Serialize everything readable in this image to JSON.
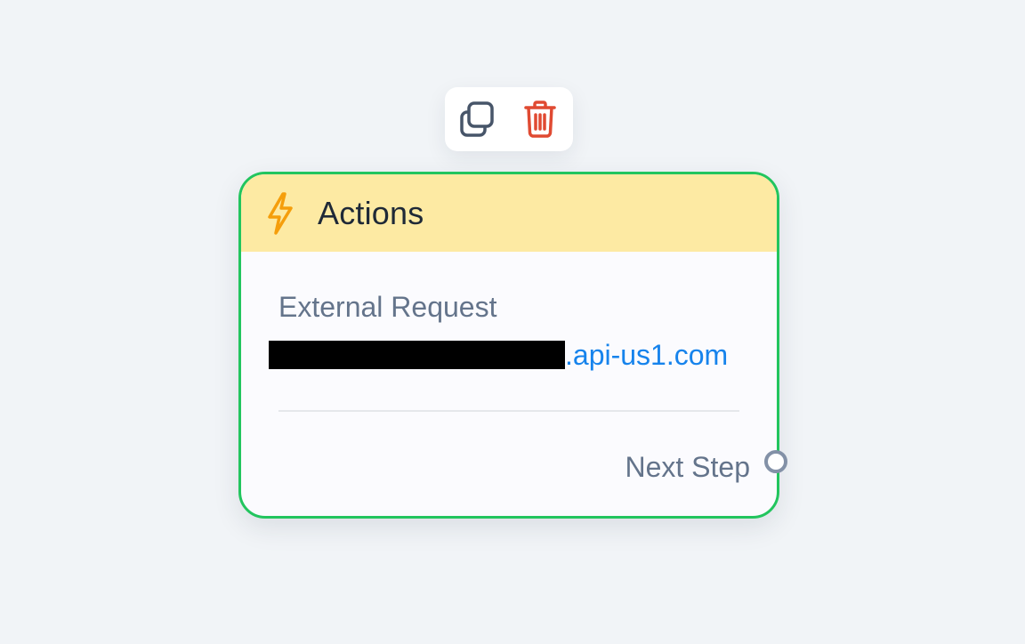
{
  "toolbar": {
    "duplicate_icon": "copy-icon",
    "delete_icon": "trash-icon",
    "delete_color": "#e04a32",
    "duplicate_color": "#475569"
  },
  "node": {
    "title": "Actions",
    "header_icon": "lightning-bolt-icon",
    "header_color": "#fdeaa3",
    "border_color": "#22c55e",
    "action_label": "External Request",
    "action_url_visible": ".api-us1.com",
    "action_url_redacted": true,
    "output_label": "Next Step"
  },
  "colors": {
    "canvas_background": "#f1f4f7",
    "link": "#1683ec",
    "bolt": "#f59e0b"
  }
}
